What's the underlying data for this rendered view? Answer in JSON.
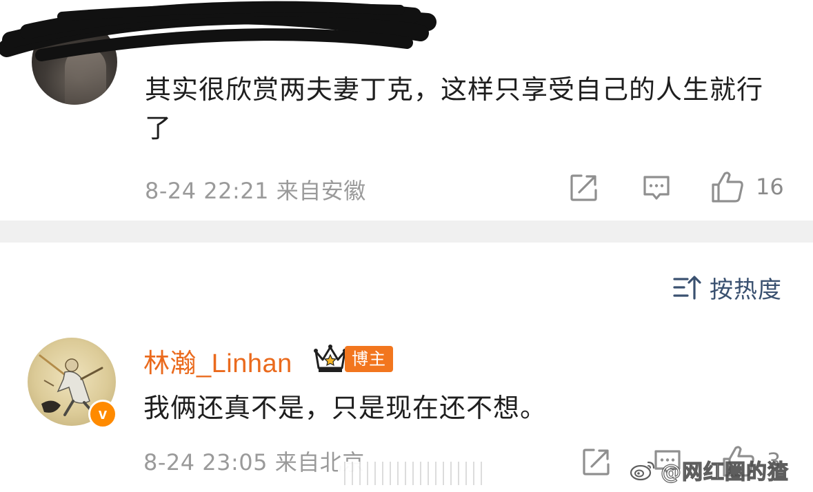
{
  "comments": [
    {
      "text": "其实很欣赏两夫妻丁克，这样只享受自己的人生就行了",
      "meta": "8-24 22:21 来自安徽",
      "like_count": "16",
      "icons": [
        "share-icon",
        "comment-icon",
        "like-icon"
      ]
    },
    {
      "username": "林瀚_Linhan",
      "badge": "v",
      "author_tag": "博主",
      "text": "我俩还真不是，只是现在还不想。",
      "meta": "8-24 23:05 来自北京",
      "like_count": "3",
      "icons": [
        "share-icon",
        "comment-icon",
        "like-icon"
      ]
    }
  ],
  "sort": {
    "label": "按热度",
    "icon": "sort-icon"
  },
  "watermark": {
    "text": "@网红圈的猹",
    "icon": "weibo-logo"
  },
  "colors": {
    "username": "#ea6a1d",
    "author_tag_bg": "#f2761e",
    "verified_badge": "#ff8a00",
    "meta_text": "#9a9a9a",
    "sort_label": "#3a5170",
    "divider": "#f0f0f0"
  }
}
